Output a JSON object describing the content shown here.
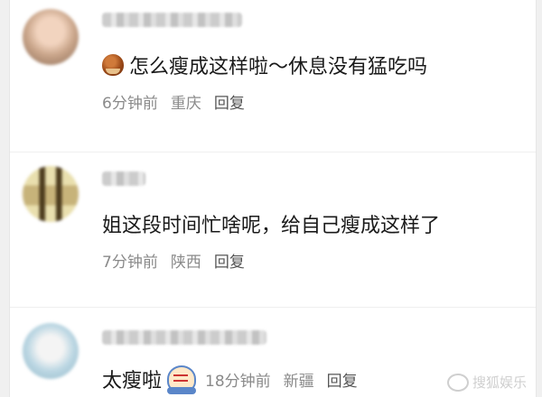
{
  "comments": [
    {
      "text": "怎么瘦成这样啦～休息没有猛吃吗",
      "time": "6分钟前",
      "location": "重庆",
      "reply": "回复",
      "emoji": "chestnut-icon"
    },
    {
      "text": "姐这段时间忙啥呢，给自己瘦成这样了",
      "time": "7分钟前",
      "location": "陕西",
      "reply": "回复"
    },
    {
      "text": "太瘦啦",
      "time": "18分钟前",
      "location": "新疆",
      "reply": "回复",
      "emoji": "crying-face-icon"
    }
  ],
  "watermark": "搜狐娱乐",
  "colors": {
    "background": "#ffffff",
    "text": "#1a1a1a",
    "meta": "#8a8a8a"
  }
}
